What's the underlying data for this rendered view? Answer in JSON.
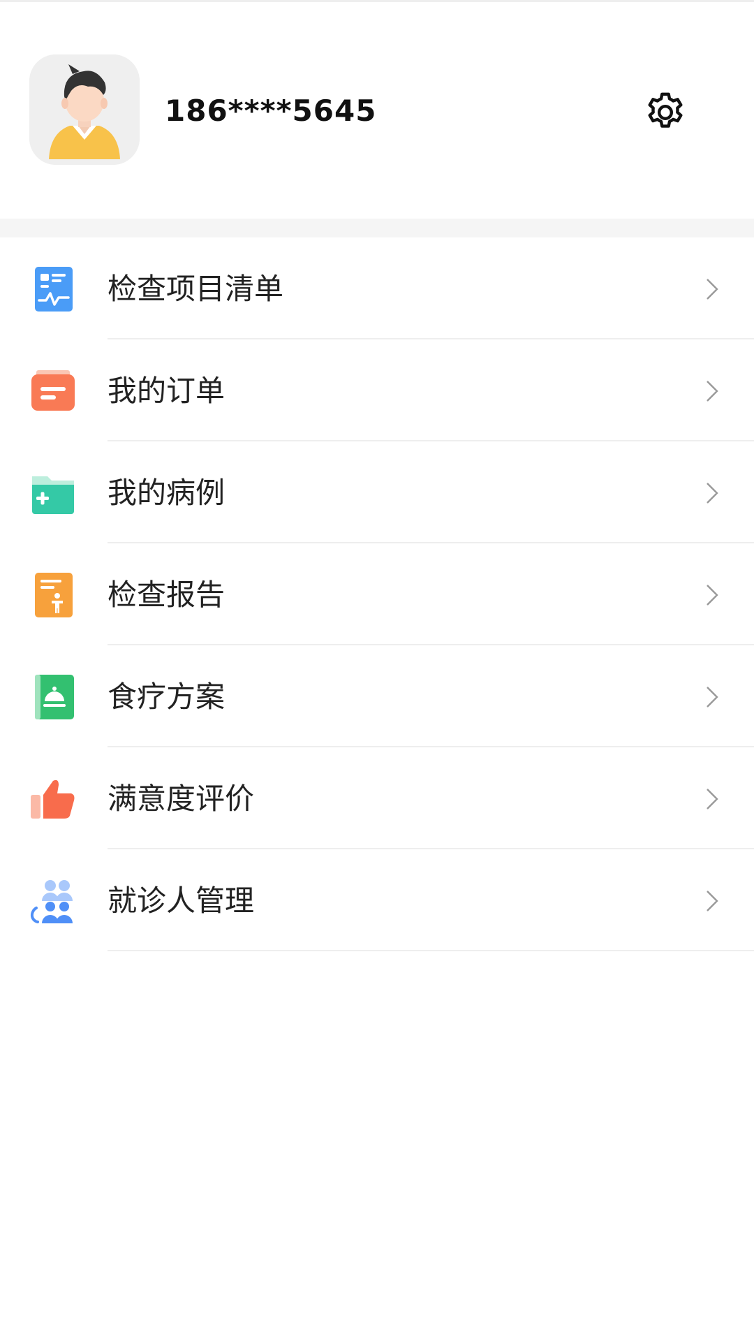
{
  "profile": {
    "phone": "186****5645"
  },
  "menu": {
    "items": [
      {
        "label": "检查项目清单",
        "icon": "checklist-icon"
      },
      {
        "label": "我的订单",
        "icon": "order-icon"
      },
      {
        "label": "我的病例",
        "icon": "medical-record-folder-icon"
      },
      {
        "label": "检查报告",
        "icon": "report-icon"
      },
      {
        "label": "食疗方案",
        "icon": "diet-plan-icon"
      },
      {
        "label": "满意度评价",
        "icon": "thumbs-up-icon"
      },
      {
        "label": "就诊人管理",
        "icon": "patients-icon"
      }
    ]
  },
  "colors": {
    "checklist": "#4a9cf7",
    "order": "#f97a55",
    "record": "#34c9a6",
    "report": "#f7a13c",
    "diet": "#33c070",
    "thumbs": "#f86c4c",
    "patients": "#4f8ff7"
  }
}
